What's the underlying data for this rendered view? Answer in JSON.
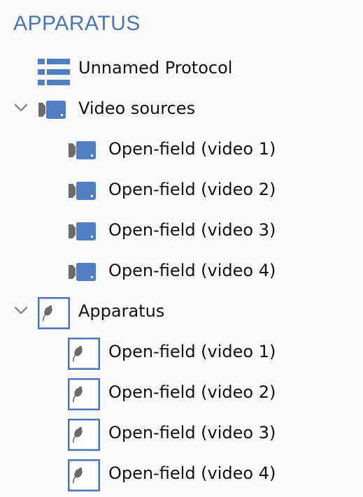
{
  "panel": {
    "title": "APPARATUS"
  },
  "tree": {
    "protocol": {
      "label": "Unnamed Protocol",
      "icon": "list-icon"
    },
    "video_sources": {
      "label": "Video sources",
      "expanded": true,
      "icon": "camera-icon",
      "children": [
        {
          "label": "Open-field (video 1)",
          "icon": "camera-icon"
        },
        {
          "label": "Open-field (video 2)",
          "icon": "camera-icon"
        },
        {
          "label": "Open-field (video 3)",
          "icon": "camera-icon"
        },
        {
          "label": "Open-field (video 4)",
          "icon": "camera-icon"
        }
      ]
    },
    "apparatus": {
      "label": "Apparatus",
      "expanded": true,
      "icon": "arena-mouse-icon",
      "children": [
        {
          "label": "Open-field (video 1)",
          "icon": "arena-mouse-icon"
        },
        {
          "label": "Open-field (video 2)",
          "icon": "arena-mouse-icon"
        },
        {
          "label": "Open-field (video 3)",
          "icon": "arena-mouse-icon"
        },
        {
          "label": "Open-field (video 4)",
          "icon": "arena-mouse-icon"
        }
      ]
    }
  },
  "colors": {
    "accent": "#4a76b8",
    "icon_blue": "#4f7fc0",
    "icon_grey": "#6b6b6b",
    "chevron": "#8a8a8a",
    "background": "#fafafa"
  }
}
